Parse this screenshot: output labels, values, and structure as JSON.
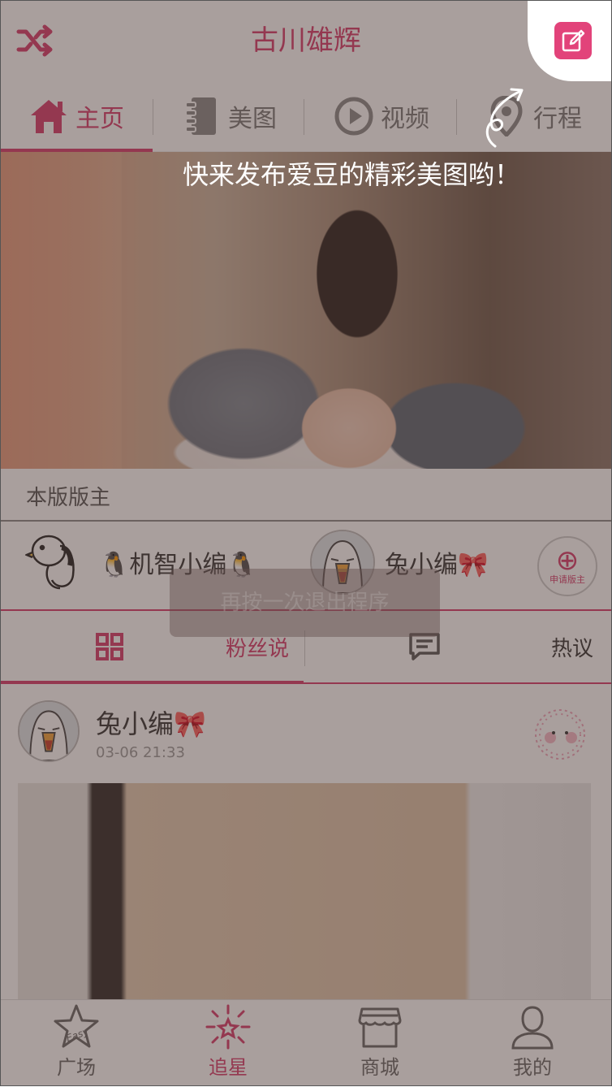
{
  "header": {
    "title": "古川雄辉"
  },
  "tabs": [
    {
      "label": "主页",
      "icon": "home-icon",
      "active": true
    },
    {
      "label": "美图",
      "icon": "notebook-icon",
      "active": false
    },
    {
      "label": "视频",
      "icon": "play-icon",
      "active": false
    },
    {
      "label": "行程",
      "icon": "location-icon",
      "active": false
    }
  ],
  "moderators": {
    "title": "本版版主",
    "items": [
      {
        "name": "🐧机智小编🐧"
      },
      {
        "name": "兔小编🎀"
      }
    ],
    "apply_label": "申请版主",
    "apply_symbol": "⊕"
  },
  "toast": {
    "text": "再按一次退出程序"
  },
  "subtabs": [
    {
      "label": "粉丝说",
      "icon": "grid-icon",
      "active": true
    },
    {
      "label": "热议",
      "icon": "comment-icon",
      "active": false
    }
  ],
  "post": {
    "author": "兔小编🎀",
    "time": "03-06 21:33"
  },
  "bottom_nav": [
    {
      "label": "广场",
      "icon": "star-icon",
      "active": false,
      "badge": "Easy"
    },
    {
      "label": "追星",
      "icon": "sparkle-star-icon",
      "active": true
    },
    {
      "label": "商城",
      "icon": "shop-icon",
      "active": false
    },
    {
      "label": "我的",
      "icon": "user-icon",
      "active": false
    }
  ],
  "guide": {
    "tip": "快来发布爱豆的精彩美图哟！"
  },
  "colors": {
    "accent": "#d63a6b",
    "compose": "#e2437a"
  }
}
